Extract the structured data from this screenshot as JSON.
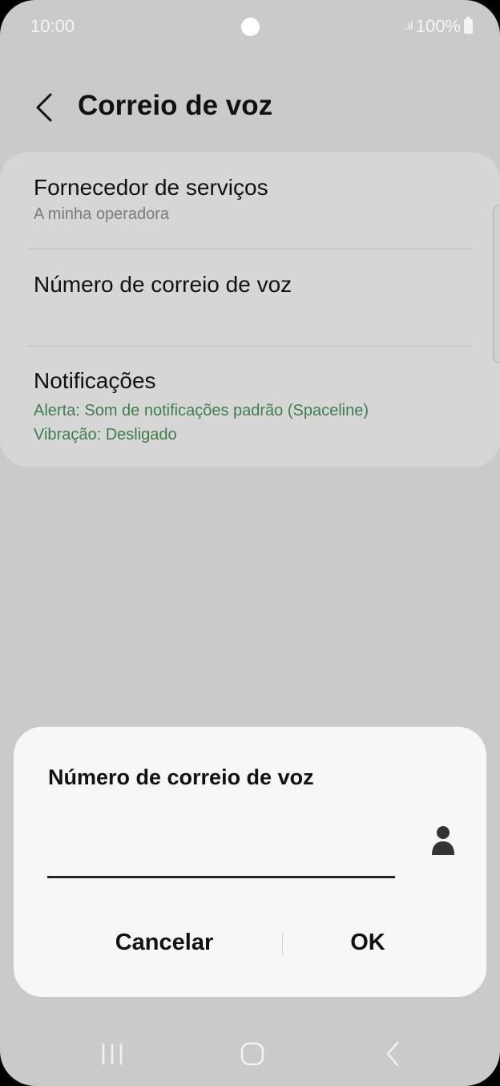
{
  "status_bar": {
    "time": "10:00",
    "signal_icon": ".ıl",
    "battery": "100%"
  },
  "header": {
    "back_icon": "chevron-left-icon",
    "title": "Correio de voz"
  },
  "settings": {
    "items": [
      {
        "title": "Fornecedor de serviços",
        "subtitle": "A minha operadora"
      },
      {
        "title": "Número de correio de voz",
        "subtitle": ""
      },
      {
        "title": "Notificações",
        "lines": [
          "Alerta: Som de notificações padrão (Spaceline)",
          "Vibração: Desligado"
        ]
      }
    ]
  },
  "dialog": {
    "title": "Número de correio de voz",
    "input_value": "",
    "contact_icon": "person-icon",
    "cancel_label": "Cancelar",
    "ok_label": "OK"
  },
  "nav_bar": {
    "recents_icon": "recents-icon",
    "home_icon": "home-icon",
    "back_icon": "back-icon"
  },
  "colors": {
    "background": "#cacaca",
    "card": "#d6d6d6",
    "dialog": "#f7f7f9",
    "accent_green": "#3e7e4e"
  }
}
